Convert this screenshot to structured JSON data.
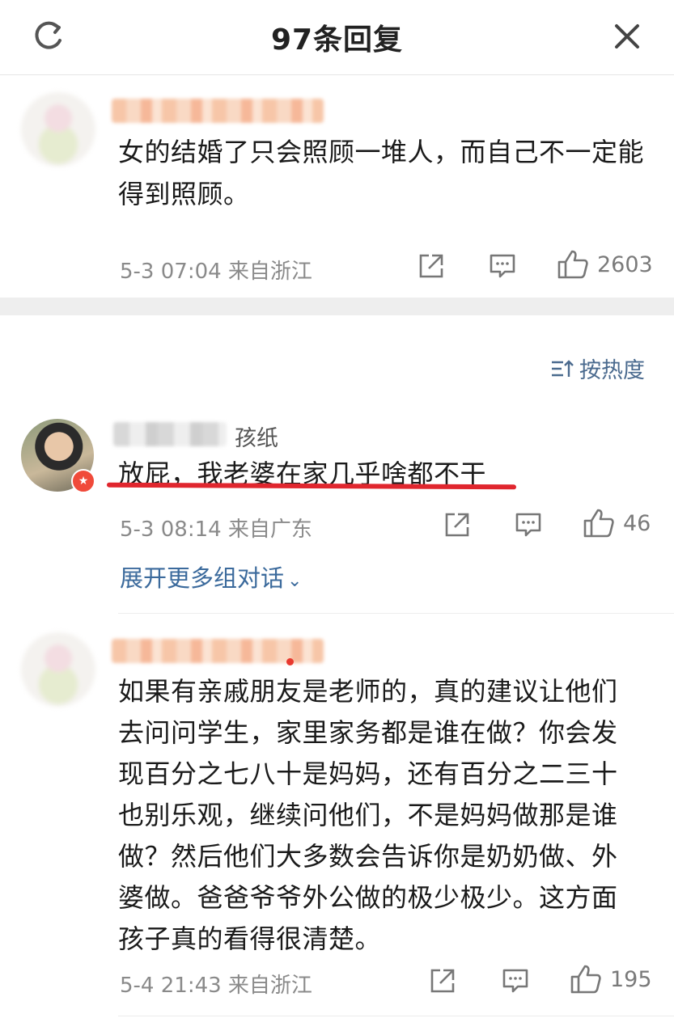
{
  "header": {
    "title": "97条回复",
    "refresh_icon": "refresh-icon",
    "close_icon": "close-icon"
  },
  "pinned_comment": {
    "text": "女的结婚了只会照顾一堆人，而自己不一定能得到照顾。",
    "meta": "5-3 07:04  来自浙江",
    "likes": "2603"
  },
  "sort": {
    "label": "按热度",
    "icon": "sort-icon"
  },
  "comments": [
    {
      "username_suffix": "孩纸",
      "text": "放屁，我老婆在家几乎啥都不干",
      "meta": "5-3 08:14  来自广东",
      "likes": "46",
      "expand_label": "展开更多组对话"
    },
    {
      "text": "如果有亲戚朋友是老师的，真的建议让他们去问问学生，家里家务都是谁在做？你会发现百分之七八十是妈妈，还有百分之二三十也别乐观，继续问他们，不是妈妈做那是谁做？然后他们大多数会告诉你是奶奶做、外婆做。爸爸爷爷外公做的极少极少。这方面孩子真的看得很清楚。",
      "meta": "5-4 21:43  来自浙江",
      "likes": "195"
    }
  ],
  "colors": {
    "link": "#3b6a9c",
    "underline": "#e0262e",
    "meta": "#8a8a8a"
  }
}
